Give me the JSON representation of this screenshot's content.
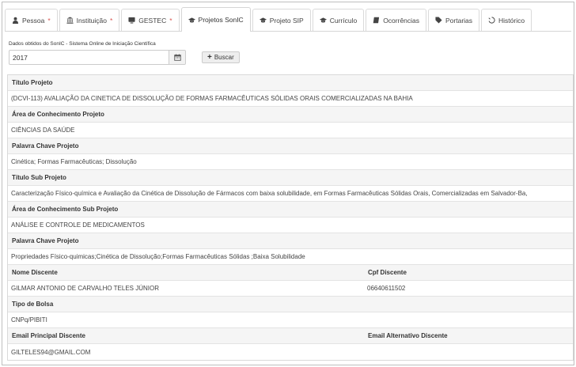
{
  "tabs": [
    {
      "label": "Pessoa",
      "required": "*",
      "icon": "user-icon"
    },
    {
      "label": "Instituição",
      "required": "*",
      "icon": "institution-icon"
    },
    {
      "label": "GESTEC",
      "required": "*",
      "icon": "tv-icon"
    },
    {
      "label": "Projetos SonIC",
      "required": "",
      "icon": "graduation-cap-icon"
    },
    {
      "label": "Projeto SIP",
      "required": "",
      "icon": "graduation-cap-icon"
    },
    {
      "label": "Currículo",
      "required": "",
      "icon": "graduation-cap-icon"
    },
    {
      "label": "Ocorrências",
      "required": "",
      "icon": "book-icon"
    },
    {
      "label": "Portarias",
      "required": "",
      "icon": "tag-icon"
    },
    {
      "label": "Histórico",
      "required": "",
      "icon": "history-icon"
    }
  ],
  "active_tab": "Projetos SonIC",
  "search": {
    "source_label": "Dados obtidos do SonIC - Sistema Online de Iniciação Científica",
    "year_value": "2017",
    "calendar_icon": "calendar-icon",
    "buscar_label": "Buscar"
  },
  "project": {
    "titulo_label": "Título Projeto",
    "titulo_value": "(DCVI-113) AVALIAÇÃO DA CINETICA DE DISSOLUÇÃO DE FORMAS FARMACÊUTICAS SÓLIDAS ORAIS COMERCIALIZADAS NA BAHIA",
    "area_label": "Área de Conhecimento Projeto",
    "area_value": "CIÊNCIAS DA SAÚDE",
    "palavra_label": "Palavra Chave Projeto",
    "palavra_value": "Cinética; Formas Farmacêuticas; Dissolução",
    "sub_titulo_label": "Título Sub Projeto",
    "sub_titulo_value": "Caracterização Físico-química e Avaliação da Cinética de Dissolução de Fármacos com baixa solubilidade, em Formas Farmacêuticas Sólidas Orais, Comercializadas em Salvador-Ba,",
    "sub_area_label": "Área de Conhecimento Sub Projeto",
    "sub_area_value": "ANÁLISE E CONTROLE DE MEDICAMENTOS",
    "sub_palavra_label": "Palavra Chave Projeto",
    "sub_palavra_value": "Propriedades Físico-quimicas;Cinética de Dissolução;Formas Farmacêuticas Sólidas ;Baixa Solubilidade",
    "nome_label": "Nome Discente",
    "nome_value": "GILMAR ANTONIO DE CARVALHO TELES JÚNIOR",
    "cpf_label": "Cpf Discente",
    "cpf_value": "06640611502",
    "bolsa_label": "Tipo de Bolsa",
    "bolsa_value": "CNPq/PIBITI",
    "email_label": "Email Principal Discente",
    "email_alt_label": "Email Alternativo Discente",
    "email_value": "GILTELES94@GMAIL.COM",
    "email_alt_value": ""
  }
}
